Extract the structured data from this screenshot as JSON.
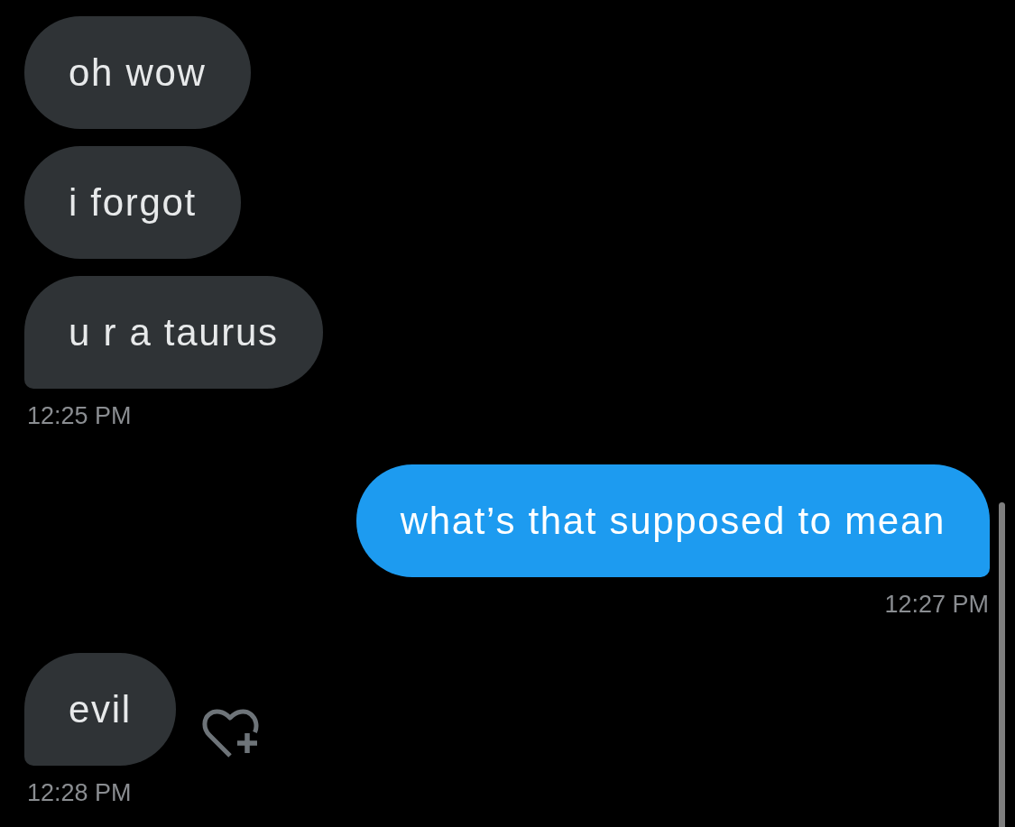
{
  "messages": [
    {
      "kind": "received",
      "bubbles": [
        "oh wow",
        "i forgot",
        "u r a taurus"
      ],
      "time": "12:25 PM",
      "react_button": false
    },
    {
      "kind": "sent",
      "bubbles": [
        "what’s that supposed to mean"
      ],
      "time": "12:27 PM",
      "react_button": false
    },
    {
      "kind": "received",
      "bubbles": [
        "evil"
      ],
      "time": "12:28 PM",
      "react_button": true
    }
  ]
}
